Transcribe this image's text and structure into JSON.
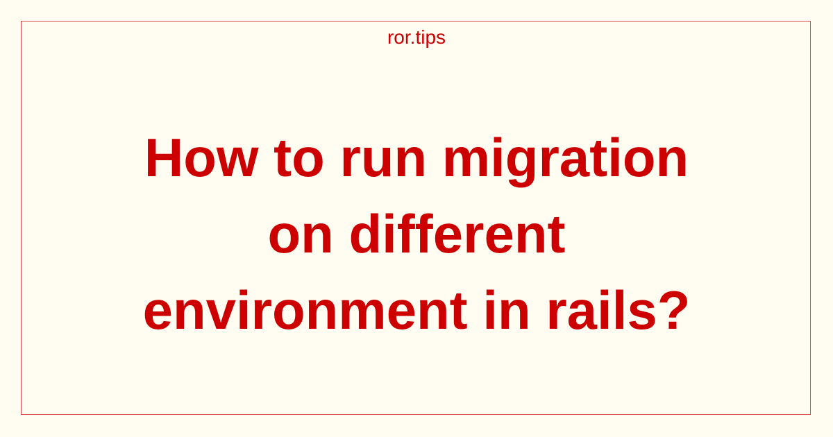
{
  "site": {
    "name": "ror.tips"
  },
  "article": {
    "title_lines": [
      "How to run migration",
      "on different",
      "environment in rails?"
    ]
  },
  "colors": {
    "background": "#fffdf1",
    "accent": "#cc0000",
    "border": "#d94a4a"
  }
}
